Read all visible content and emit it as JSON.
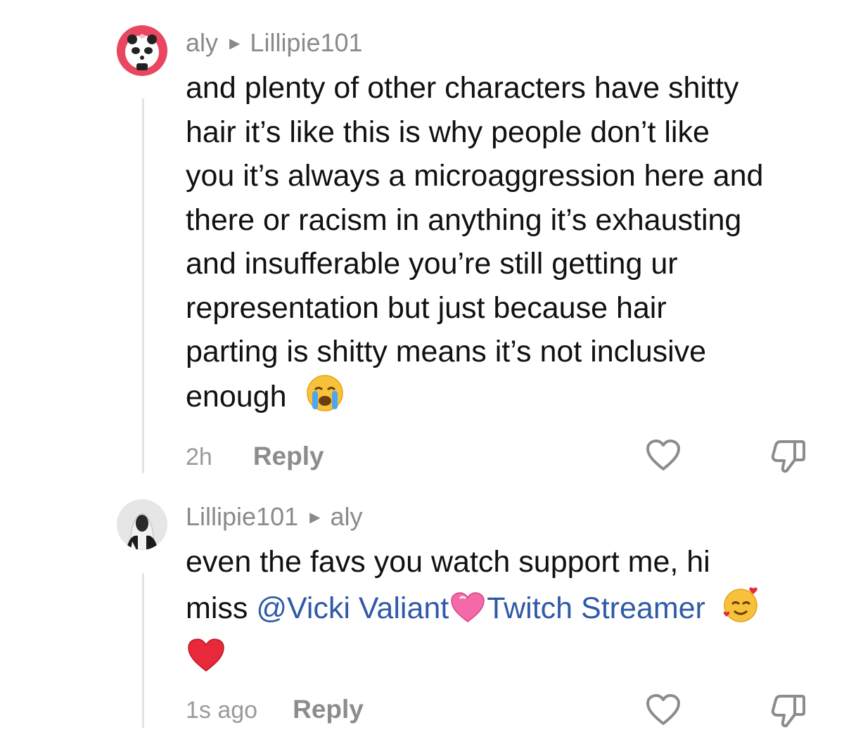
{
  "comments": [
    {
      "author": "aly",
      "reply_to": "Lillipie101",
      "lines": [
        "and plenty of other characters have shitty",
        "hair it’s like this is why people don’t like",
        "you it’s always a microaggression here and",
        "there or racism in anything it’s exhausting",
        "and insufferable you’re still getting ur",
        "representation but just because hair",
        "parting is shitty means it’s not inclusive",
        "enough"
      ],
      "time": "2h",
      "reply_label": "Reply"
    },
    {
      "author": "Lillipie101",
      "reply_to": "aly",
      "line1": "even the favs you watch support me, hi",
      "line2_prefix": "miss ",
      "mention_name": "@Vicki Valiant",
      "mention_suffix": "Twitch Streamer",
      "time": "1s ago",
      "reply_label": "Reply"
    }
  ],
  "colors": {
    "mention": "#2f5aa8",
    "username": "#8a8a8a",
    "avatar_ring": "#e8475f"
  },
  "icons": [
    "reply-arrow-icon",
    "heart-outline-icon",
    "thumbs-down-icon",
    "crying-face-emoji",
    "pink-heart-emoji",
    "smiling-hearts-emoji",
    "red-heart-emoji"
  ]
}
